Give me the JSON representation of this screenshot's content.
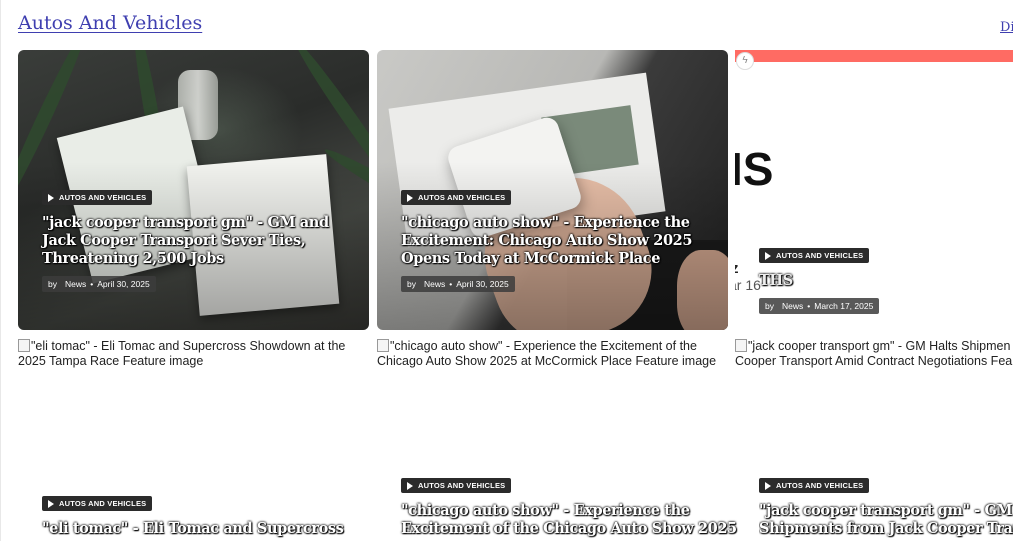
{
  "section": {
    "title": "Autos And Vehicles",
    "view_all": "Di"
  },
  "cards": [
    {
      "category": "AUTOS AND VEHICLES",
      "title": "\"jack cooper transport gm\" - GM and Jack Cooper Transport Sever Ties, Threatening 2,500 Jobs",
      "by": "by",
      "author": "News",
      "date": "April 30, 2025"
    },
    {
      "category": "AUTOS AND VEHICLES",
      "title": "\"chicago auto show\" - Experience the Excitement: Chicago Auto Show 2025 Opens Today at McCormick Place",
      "by": "by",
      "author": "News",
      "date": "April 30, 2025"
    },
    {
      "category": "AUTOS AND VEHICLES",
      "title": "THS",
      "big_text": "IS",
      "z_text": "z",
      "date_fragment": "ar 16",
      "by": "by",
      "author": "News",
      "date": "March 17, 2025"
    }
  ],
  "row2": [
    {
      "alt": "\"eli tomac\" - Eli Tomac and Supercross Showdown at the 2025 Tampa Race Feature image",
      "alt_line1": "\"eli tomac\" - Eli Tomac and Supercross Showdown at the",
      "alt_line2": "2025 Tampa Race Feature image",
      "category": "AUTOS AND VEHICLES",
      "title": "\"eli tomac\" - Eli Tomac and Supercross"
    },
    {
      "alt_line1": "\"chicago auto show\" - Experience the Excitement of the",
      "alt_line2": "Chicago Auto Show 2025 at McCormick Place Feature image",
      "category": "AUTOS AND VEHICLES",
      "title_line1": "\"chicago auto show\" - Experience the",
      "title_line2": "Excitement of the Chicago Auto Show 2025"
    },
    {
      "alt_line1": "\"jack cooper transport gm\" - GM Halts Shipmen",
      "alt_line2": "Cooper Transport Amid Contract Negotiations Fea",
      "category": "AUTOS AND VEHICLES",
      "title_line1": "\"jack cooper transport gm\" - GM Hal",
      "title_line2": "Shipments from Jack Cooper Transp"
    }
  ]
}
